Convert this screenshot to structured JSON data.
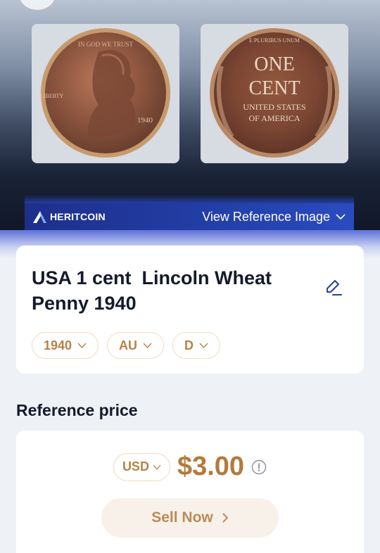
{
  "hero": {
    "obverse": {
      "legend": "IN GOD WE TRUST",
      "liberty": "LIBERTY",
      "year": "1940"
    },
    "reverse": {
      "motto": "E PLURIBUS UNUM",
      "denomination_line1": "ONE",
      "denomination_line2": "CENT",
      "country_line1": "UNITED STATES",
      "country_line2": "OF AMERICA"
    }
  },
  "brand_bar": {
    "brand_name": "HERITCOIN",
    "view_reference_label": "View Reference Image"
  },
  "coin": {
    "title": "USA 1 cent  Lincoln Wheat Penny 1940",
    "chips": [
      {
        "label": "1940"
      },
      {
        "label": "AU"
      },
      {
        "label": "D"
      }
    ]
  },
  "reference": {
    "heading": "Reference price",
    "currency": "USD",
    "price": "$3.00",
    "sell_label": "Sell Now"
  },
  "colors": {
    "accent_gold": "#b47a3d",
    "chip_border": "#ecdcc6",
    "brand_blue": "#233fa9",
    "title_text": "#141a2b"
  },
  "icons": [
    "edit-icon",
    "chevron-down-icon",
    "info-icon",
    "chevron-right-icon",
    "heritcoin-logo-icon"
  ]
}
